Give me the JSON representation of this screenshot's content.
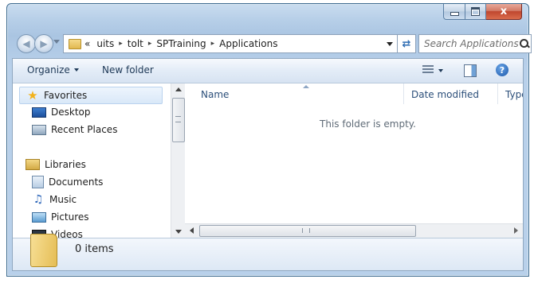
{
  "window": {
    "close_glyph": "x"
  },
  "address_bar": {
    "overflow": "«",
    "crumbs": [
      "uits",
      "tolt",
      "SPTraining",
      "Applications"
    ],
    "separator": "▸"
  },
  "search": {
    "placeholder": "Search Applications"
  },
  "toolbar": {
    "organize_label": "Organize",
    "new_folder_label": "New folder",
    "help_glyph": "?"
  },
  "nav_pane": {
    "favorites": {
      "label": "Favorites",
      "items": [
        "Desktop",
        "Recent Places"
      ]
    },
    "libraries": {
      "label": "Libraries",
      "items": [
        "Documents",
        "Music",
        "Pictures",
        "Videos"
      ]
    }
  },
  "columns": {
    "name": "Name",
    "date_modified": "Date modified",
    "type": "Type"
  },
  "content": {
    "empty_message": "This folder is empty."
  },
  "details_pane": {
    "item_count": "0 items"
  },
  "icons": {
    "back": "back-arrow-icon",
    "forward": "forward-arrow-icon",
    "refresh": "refresh-icon",
    "search": "search-icon",
    "views": "views-icon",
    "preview": "preview-pane-icon",
    "help": "help-icon"
  }
}
